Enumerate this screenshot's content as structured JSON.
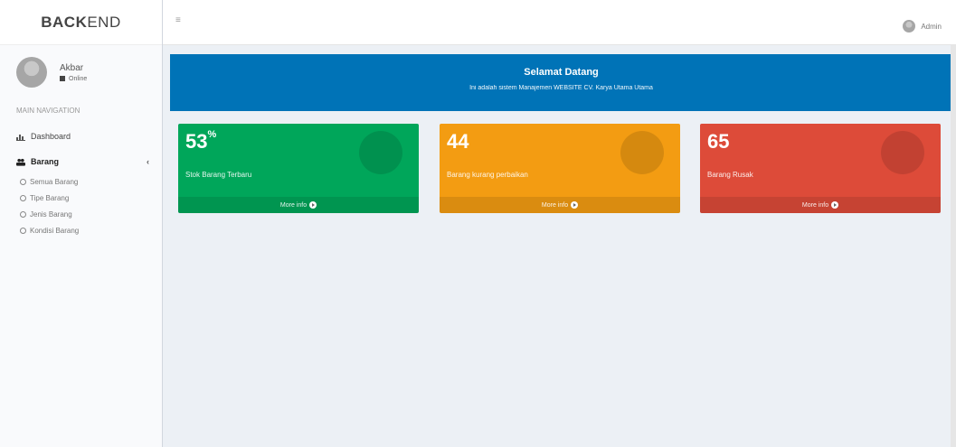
{
  "brand": {
    "bold": "BACK",
    "light": "END"
  },
  "user": {
    "name": "Akbar",
    "status": "Online"
  },
  "sidebar": {
    "header": "MAIN NAVIGATION",
    "items": [
      {
        "label": "Dashboard",
        "icon": "bar-chart-icon"
      },
      {
        "label": "Barang",
        "icon": "users-icon"
      }
    ],
    "submenu": [
      "Semua Barang",
      "Tipe Barang",
      "Jenis Barang",
      "Kondisi Barang"
    ]
  },
  "topbar": {
    "username": "Admin"
  },
  "welcome": {
    "title": "Selamat Datang",
    "subtitle": "Ini adalah sistem Manajemen WEBSITE CV. Karya Utama Utama"
  },
  "boxes": [
    {
      "number": "53",
      "suffix": "%",
      "text": "Stok Barang Terbaru",
      "footer": "More info",
      "color": "#00a65a"
    },
    {
      "number": "44",
      "suffix": "",
      "text": "Barang kurang perbaikan",
      "footer": "More info",
      "color": "#f39c12"
    },
    {
      "number": "65",
      "suffix": "",
      "text": "Barang Rusak",
      "footer": "More info",
      "color": "#dd4b39"
    }
  ]
}
